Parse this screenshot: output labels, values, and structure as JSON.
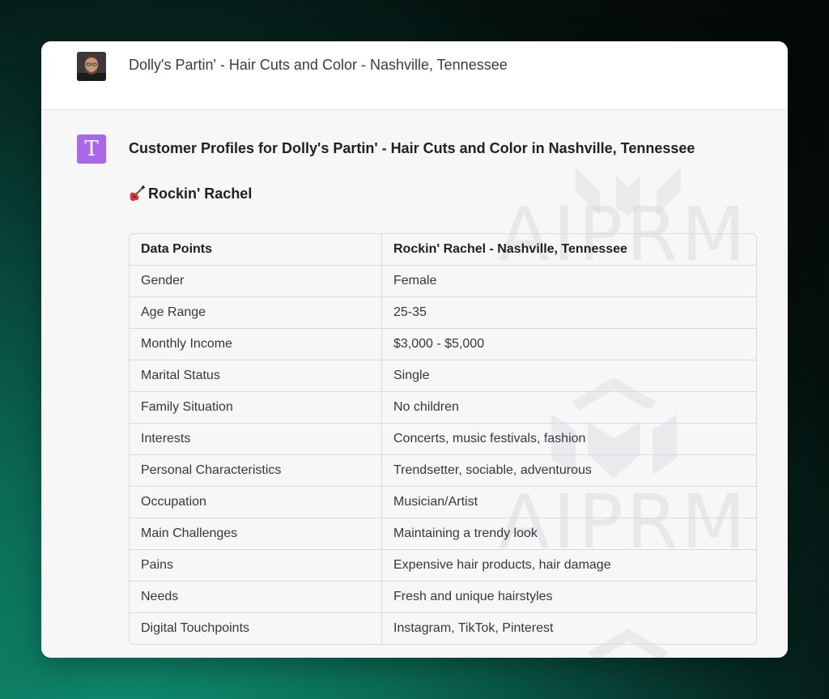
{
  "user_message": {
    "text": "Dolly's Partin' - Hair Cuts and Color - Nashville, Tennessee"
  },
  "assistant": {
    "avatar_letter": "T",
    "avatar_color": "#ab68e6",
    "heading": "Customer Profiles for Dolly's Partin' - Hair Cuts and Color in Nashville, Tennessee",
    "subheading_icon": "guitar-icon",
    "subheading": "Rockin' Rachel",
    "watermark_text": "AIPRM",
    "table": {
      "headers": [
        "Data Points",
        "Rockin' Rachel - Nashville, Tennessee"
      ],
      "rows": [
        [
          "Gender",
          "Female"
        ],
        [
          "Age Range",
          "25-35"
        ],
        [
          "Monthly Income",
          "$3,000 - $5,000"
        ],
        [
          "Marital Status",
          "Single"
        ],
        [
          "Family Situation",
          "No children"
        ],
        [
          "Interests",
          "Concerts, music festivals, fashion"
        ],
        [
          "Personal Characteristics",
          "Trendsetter, sociable, adventurous"
        ],
        [
          "Occupation",
          "Musician/Artist"
        ],
        [
          "Main Challenges",
          "Maintaining a trendy look"
        ],
        [
          "Pains",
          "Expensive hair products, hair damage"
        ],
        [
          "Needs",
          "Fresh and unique hairstyles"
        ],
        [
          "Digital Touchpoints",
          "Instagram, TikTok, Pinterest"
        ]
      ]
    }
  }
}
